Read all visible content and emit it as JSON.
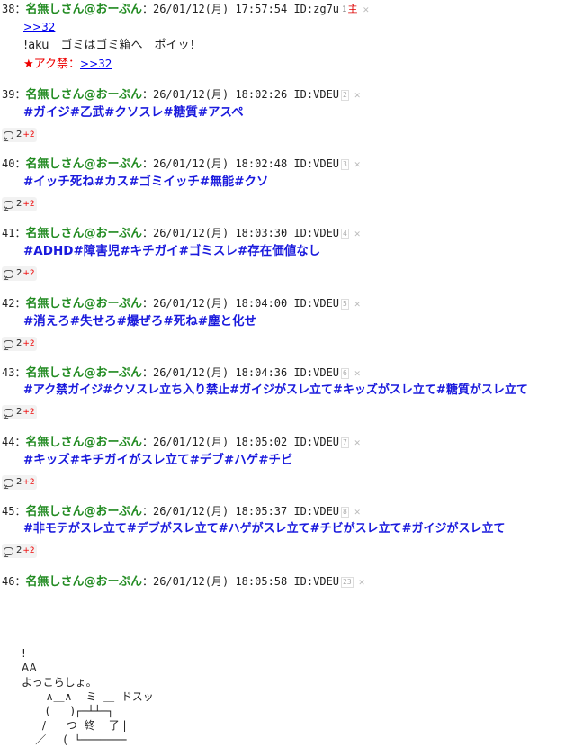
{
  "posts": [
    {
      "num": "38",
      "name": "名無しさん@おーぷん",
      "meta": "26/01/12(月) 17:57:54 ID:zg7u",
      "idcount": "1",
      "idlabel": "主",
      "anchor": ">>32",
      "text": "!aku　ゴミはゴミ箱へ　ポイッ！",
      "ban_label": "★アク禁：",
      "ban_anchor": ">>32"
    },
    {
      "num": "39",
      "name": "名無しさん@おーぷん",
      "meta": "26/01/12(月) 18:02:26 ID:VDEU",
      "idcount": "2",
      "tags": "#ガイジ#乙武#クソスレ#糖質#アスペ",
      "res": "2",
      "res_plus": "+2"
    },
    {
      "num": "40",
      "name": "名無しさん@おーぷん",
      "meta": "26/01/12(月) 18:02:48 ID:VDEU",
      "idcount": "3",
      "tags": "#イッチ死ね#カス#ゴミイッチ#無能#クソ",
      "res": "2",
      "res_plus": "+2"
    },
    {
      "num": "41",
      "name": "名無しさん@おーぷん",
      "meta": "26/01/12(月) 18:03:30 ID:VDEU",
      "idcount": "4",
      "tags": "#ADHD#障害児#キチガイ#ゴミスレ#存在価値なし",
      "res": "2",
      "res_plus": "+2"
    },
    {
      "num": "42",
      "name": "名無しさん@おーぷん",
      "meta": "26/01/12(月) 18:04:00 ID:VDEU",
      "idcount": "5",
      "tags": "#消えろ#失せろ#爆ぜろ#死ね#塵と化せ",
      "res": "2",
      "res_plus": "+2"
    },
    {
      "num": "43",
      "name": "名無しさん@おーぷん",
      "meta": "26/01/12(月) 18:04:36 ID:VDEU",
      "idcount": "6",
      "tags": "#アク禁ガイジ#クソスレ立ち入り禁止#ガイジがスレ立て#キッズがスレ立て#糖質がスレ立て",
      "res": "2",
      "res_plus": "+2"
    },
    {
      "num": "44",
      "name": "名無しさん@おーぷん",
      "meta": "26/01/12(月) 18:05:02 ID:VDEU",
      "idcount": "7",
      "tags": "#キッズ#キチガイがスレ立て#デブ#ハゲ#チビ",
      "res": "2",
      "res_plus": "+2"
    },
    {
      "num": "45",
      "name": "名無しさん@おーぷん",
      "meta": "26/01/12(月) 18:05:37 ID:VDEU",
      "idcount": "8",
      "tags": "#非モテがスレ立て#デブがスレ立て#ハゲがスレ立て#チビがスレ立て#ガイジがスレ立て",
      "res": "2",
      "res_plus": "+2"
    },
    {
      "num": "46",
      "name": "名無しさん@おーぷん",
      "meta": "26/01/12(月) 18:05:58 ID:VDEU",
      "idcount": "23"
    }
  ],
  "aa_text": "!\nAA\nよっこらしょ。\n       ∧＿∧    ミ  ＿  ドスッ\n       (      )┌─┴┴─┐\n      /      つ  終    了 |\n    ／     (  └───────"
}
